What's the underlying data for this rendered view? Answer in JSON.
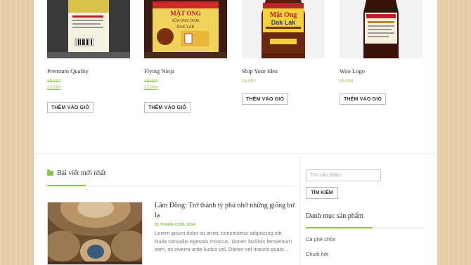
{
  "products": [
    {
      "name": "Premium Quality",
      "old_price": "15.00₫",
      "price": "12.00₫",
      "button": "THÊM VÀO GIỎ"
    },
    {
      "name": "Flying Ninja",
      "old_price": "15.00₫",
      "price": "12.00₫",
      "button": "THÊM VÀO GIỎ",
      "label_lines": [
        "MẬT ONG",
        "SỮA ONG CHÚA",
        "DAK LAK"
      ]
    },
    {
      "name": "Ship Your Idea",
      "price": "15.00₫",
      "button": "THÊM VÀO GIỎ",
      "label_lines": [
        "Mật Ong",
        "Dak Lak"
      ]
    },
    {
      "name": "Woo Logo",
      "price": "35.00₫",
      "button": "THÊM VÀO GIỎ"
    }
  ],
  "recent_posts": {
    "title": "Bài viết mới nhất",
    "post": {
      "title": "Lâm Đồng: Trở thành tỷ phú nhờ những giống bơ lạ",
      "date": "25 THÁNG CHÍN, 2014",
      "excerpt": "Lorem ipsum dolor sit amet, consectetur adipiscing elit. Nulla convallis egestas rhoncus. Donec facilisis fermentum sem, ac viverra ante luctus vel. Donec vel mauris quam..."
    }
  },
  "sidebar": {
    "search_placeholder": "Tìm sản phẩm...",
    "search_button": "TÌM KIẾM",
    "categories_title": "Danh mục sản phẩm",
    "categories": [
      "Cà phê chồn",
      "Chuối hột"
    ]
  },
  "colors": {
    "accent": "#8bc34a",
    "background": "#e8cfa6"
  }
}
